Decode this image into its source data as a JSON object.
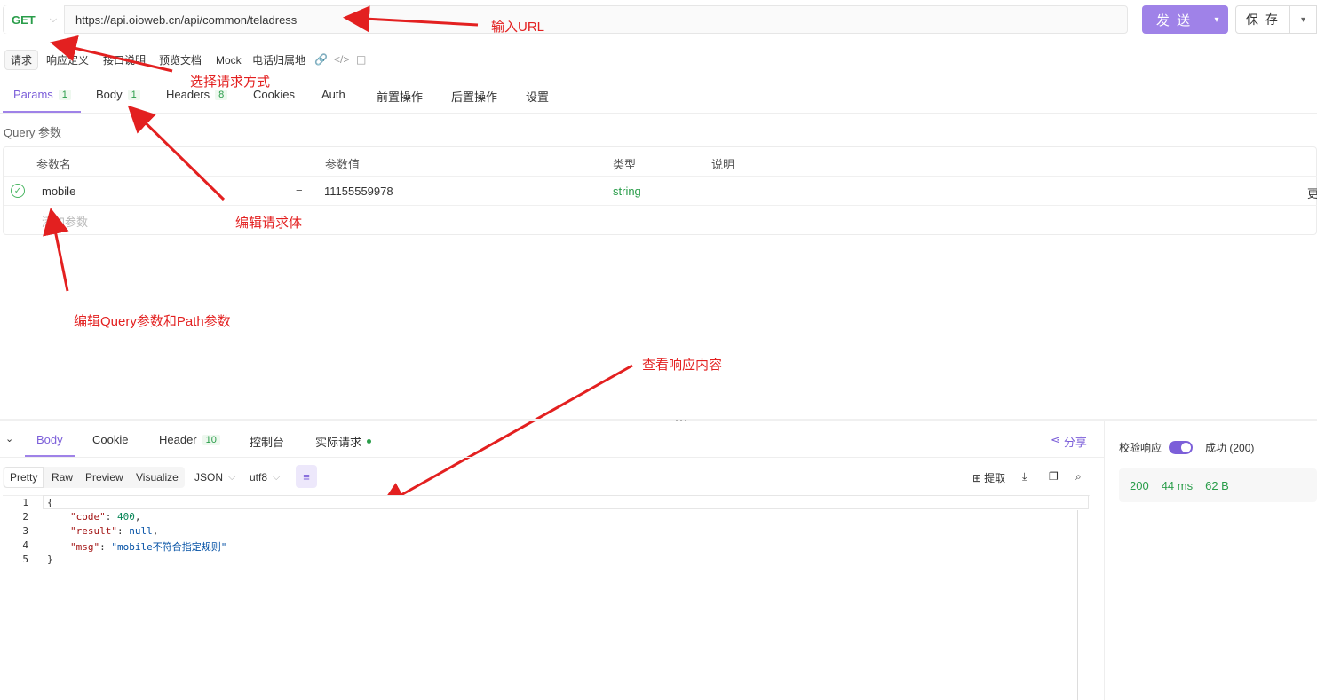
{
  "request": {
    "method": "GET",
    "url": "https://api.oioweb.cn/api/common/teladress",
    "send_label": "发 送",
    "save_label": "保 存"
  },
  "subtabs": [
    {
      "label": "请求",
      "active": true
    },
    {
      "label": "响应定义"
    },
    {
      "label": "接口说明"
    },
    {
      "label": "预览文档"
    },
    {
      "label": "Mock"
    },
    {
      "label": "电话归属地"
    }
  ],
  "tabs": [
    {
      "label": "Params",
      "badge": "1",
      "active": true
    },
    {
      "label": "Body",
      "badge": "1"
    },
    {
      "label": "Headers",
      "badge": "8"
    },
    {
      "label": "Cookies"
    },
    {
      "label": "Auth"
    },
    {
      "label": "前置操作"
    },
    {
      "label": "后置操作"
    },
    {
      "label": "设置"
    }
  ],
  "query": {
    "section_label": "Query 参数",
    "headers": [
      "参数名",
      "参数值",
      "类型",
      "说明"
    ],
    "rows": [
      {
        "name": "mobile",
        "eq": "=",
        "value": "11155559978",
        "type": "string",
        "desc": "",
        "more": "更"
      }
    ],
    "add_placeholder": "添加参数"
  },
  "annotations": {
    "input_url": "输入URL",
    "choose_method": "选择请求方式",
    "edit_body": "编辑请求体",
    "edit_query": "编辑Query参数和Path参数",
    "view_response": "查看响应内容"
  },
  "response": {
    "tabs": [
      {
        "label": "Body",
        "active": true
      },
      {
        "label": "Cookie"
      },
      {
        "label": "Header",
        "badge": "10"
      },
      {
        "label": "控制台"
      },
      {
        "label": "实际请求"
      }
    ],
    "share_label": "分享",
    "view_modes": [
      "Pretty",
      "Raw",
      "Preview",
      "Visualize"
    ],
    "format": "JSON",
    "encoding": "utf8",
    "extract_label": "提取",
    "code_lines": [
      "1",
      "2",
      "3",
      "4",
      "5"
    ],
    "json": {
      "code_key": "\"code\"",
      "code_val": "400",
      "result_key": "\"result\"",
      "result_val": "null",
      "msg_key": "\"msg\"",
      "msg_val": "\"mobile不符合指定规则\""
    },
    "validate_label": "校验响应",
    "success_label": "成功 (200)",
    "status": "200",
    "time": "44 ms",
    "size": "62 B"
  },
  "colors": {
    "accent": "#9f82e8",
    "annotation": "#e32020",
    "success": "#2a9d4a"
  }
}
